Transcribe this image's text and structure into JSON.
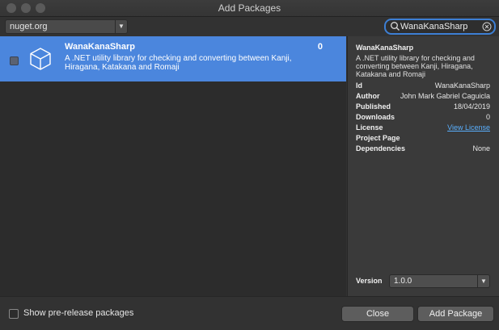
{
  "window": {
    "title": "Add Packages"
  },
  "toolbar": {
    "source": "nuget.org",
    "search_value": "WanaKanaSharp"
  },
  "results": [
    {
      "name": "WanaKanaSharp",
      "count": "0",
      "description": "A .NET utility library for checking and converting between Kanji, Hiragana, Katakana and Romaji",
      "selected": true,
      "checked": false
    }
  ],
  "details": {
    "title": "WanaKanaSharp",
    "description": "A .NET utility library for checking and converting between Kanji, Hiragana, Katakana and Romaji",
    "fields": [
      {
        "label": "Id",
        "value": "WanaKanaSharp"
      },
      {
        "label": "Author",
        "value": "John Mark Gabriel Caguicla"
      },
      {
        "label": "Published",
        "value": "18/04/2019"
      },
      {
        "label": "Downloads",
        "value": "0"
      },
      {
        "label": "License",
        "value": "View License"
      },
      {
        "label": "Project Page",
        "value": ""
      },
      {
        "label": "Dependencies",
        "value": "None"
      }
    ],
    "version_label": "Version",
    "version_value": "1.0.0"
  },
  "footer": {
    "prerelease_label": "Show pre-release packages",
    "close_label": "Close",
    "add_label": "Add Package"
  },
  "colors": {
    "selection": "#4b86dd",
    "focus_ring": "#3d7fd4",
    "link": "#5ab0ff"
  }
}
